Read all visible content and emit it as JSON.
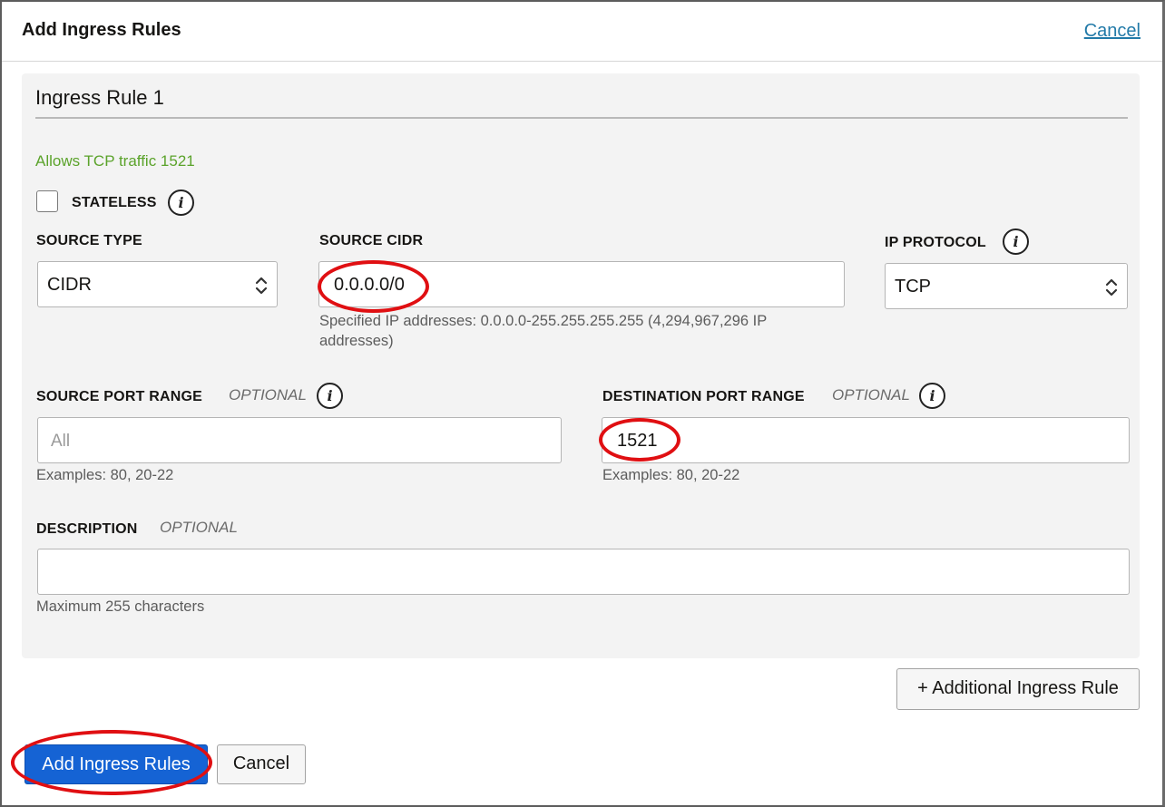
{
  "header": {
    "title": "Add Ingress Rules",
    "cancel_link": "Cancel"
  },
  "rule": {
    "title": "Ingress Rule 1",
    "summary": "Allows TCP traffic 1521",
    "stateless_label": "STATELESS",
    "stateless_checked": false,
    "source_type": {
      "label": "SOURCE TYPE",
      "value": "CIDR"
    },
    "source_cidr": {
      "label": "SOURCE CIDR",
      "value": "0.0.0.0/0",
      "helper_line1": "Specified IP addresses: 0.0.0.0-255.255.255.255 (4,294,967,296 IP",
      "helper_line2": "addresses)"
    },
    "ip_protocol": {
      "label": "IP PROTOCOL",
      "value": "TCP"
    },
    "source_port_range": {
      "label": "SOURCE PORT RANGE",
      "optional": "OPTIONAL",
      "placeholder": "All",
      "helper": "Examples: 80, 20-22"
    },
    "destination_port_range": {
      "label": "DESTINATION PORT RANGE",
      "optional": "OPTIONAL",
      "value": "1521",
      "helper": "Examples: 80, 20-22"
    },
    "description": {
      "label": "DESCRIPTION",
      "optional": "OPTIONAL",
      "value": "",
      "helper": "Maximum 255 characters"
    }
  },
  "additional_rule_button": "+ Additional Ingress Rule",
  "footer": {
    "primary_button": "Add Ingress Rules",
    "cancel_button": "Cancel"
  },
  "colors": {
    "primary": "#1563d4",
    "link": "#227aa8",
    "success_text": "#5ba32b",
    "annotation": "#e00f12"
  },
  "icons": {
    "info": "info-icon",
    "select": "chevron-up-down-icon"
  }
}
